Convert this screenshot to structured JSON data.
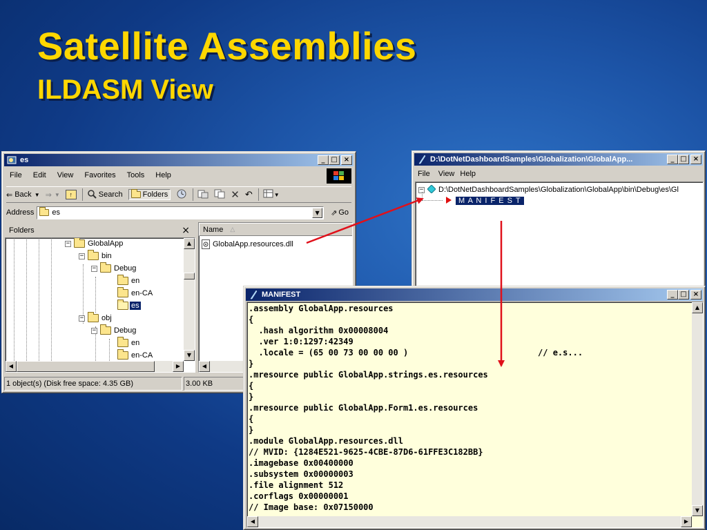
{
  "slide": {
    "title": "Satellite Assemblies",
    "subtitle": "ILDASM View"
  },
  "explorer": {
    "title": "es",
    "menu": [
      "File",
      "Edit",
      "View",
      "Favorites",
      "Tools",
      "Help"
    ],
    "toolbar": {
      "back": "Back",
      "search": "Search",
      "folders": "Folders"
    },
    "address_label": "Address",
    "address_value": "es",
    "go_label": "Go",
    "folders_pane_title": "Folders",
    "folders_close": "×",
    "tree": [
      {
        "label": "GlobalApp",
        "expander": "−"
      },
      {
        "label": "bin",
        "expander": "−"
      },
      {
        "label": "Debug",
        "expander": "−"
      },
      {
        "label": "en",
        "expander": ""
      },
      {
        "label": "en-CA",
        "expander": ""
      },
      {
        "label": "es",
        "expander": "",
        "selected": true
      },
      {
        "label": "obj",
        "expander": "−"
      },
      {
        "label": "Debug",
        "expander": "−"
      },
      {
        "label": "en",
        "expander": ""
      },
      {
        "label": "en-CA",
        "expander": ""
      }
    ],
    "column_name": "Name",
    "files": [
      "GlobalApp.resources.dll"
    ],
    "status_left": "1 object(s) (Disk free space: 4.35 GB)",
    "status_size": "3.00 KB"
  },
  "ildasm": {
    "title": "D:\\DotNetDashboardSamples\\Globalization\\GlobalApp...",
    "menu": [
      "File",
      "View",
      "Help"
    ],
    "root_path": "D:\\DotNetDashboardSamples\\Globalization\\GlobalApp\\bin\\Debug\\es\\Gl",
    "manifest_node": "M A N I F E S T"
  },
  "manifest": {
    "title": "MANIFEST",
    "lines": [
      ".assembly GlobalApp.resources",
      "{",
      "  .hash algorithm 0x00008004",
      "  .ver 1:0:1297:42349",
      "  .locale = (65 00 73 00 00 00 )                          // e.s...",
      "}",
      ".mresource public GlobalApp.strings.es.resources",
      "{",
      "}",
      ".mresource public GlobalApp.Form1.es.resources",
      "{",
      "}",
      ".module GlobalApp.resources.dll",
      "// MVID: {1284E521-9625-4CBE-87D6-61FFE3C182BB}",
      ".imagebase 0x00400000",
      ".subsystem 0x00000003",
      ".file alignment 512",
      ".corflags 0x00000001",
      "// Image base: 0x07150000"
    ]
  },
  "colors": {
    "title_yellow": "#ffd700",
    "arrow_red": "#e0101a",
    "manifest_bg": "#ffffdc",
    "selection": "#0a246a"
  },
  "window_buttons": {
    "minimize": "_",
    "maximize": "□",
    "close": "×"
  }
}
